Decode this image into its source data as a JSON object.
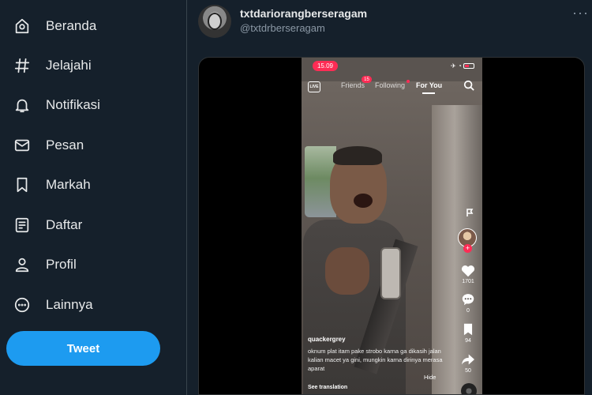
{
  "sidebar": {
    "items": [
      {
        "label": "Beranda",
        "icon": "home-icon"
      },
      {
        "label": "Jelajahi",
        "icon": "hashtag-icon"
      },
      {
        "label": "Notifikasi",
        "icon": "bell-icon"
      },
      {
        "label": "Pesan",
        "icon": "mail-icon"
      },
      {
        "label": "Markah",
        "icon": "bookmark-icon"
      },
      {
        "label": "Daftar",
        "icon": "list-icon"
      },
      {
        "label": "Profil",
        "icon": "person-icon"
      },
      {
        "label": "Lainnya",
        "icon": "more-circle-icon"
      }
    ],
    "tweet_label": "Tweet"
  },
  "tweet": {
    "display_name": "txtdariorangberseragam",
    "handle": "@txtdrberseragam",
    "more": "···"
  },
  "tiktok": {
    "time": "15.09",
    "live_label": "LIVE",
    "tabs": {
      "friends": "Friends",
      "friends_badge": "15",
      "following": "Following",
      "for_you": "For You"
    },
    "likes": "1701",
    "comments": "0",
    "bookmarks": "94",
    "shares": "50",
    "username": "quackergrey",
    "caption": "oknum plat itam pake strobo karna ga dikasih jalan kalian macet ya gini, mungkin karna dirinya merasa aparat",
    "hide_label": "Hide",
    "translation_label": "See translation"
  },
  "colors": {
    "background": "#15202b",
    "accent": "#1d9bf0",
    "tiktok_red": "#fe2c55"
  }
}
